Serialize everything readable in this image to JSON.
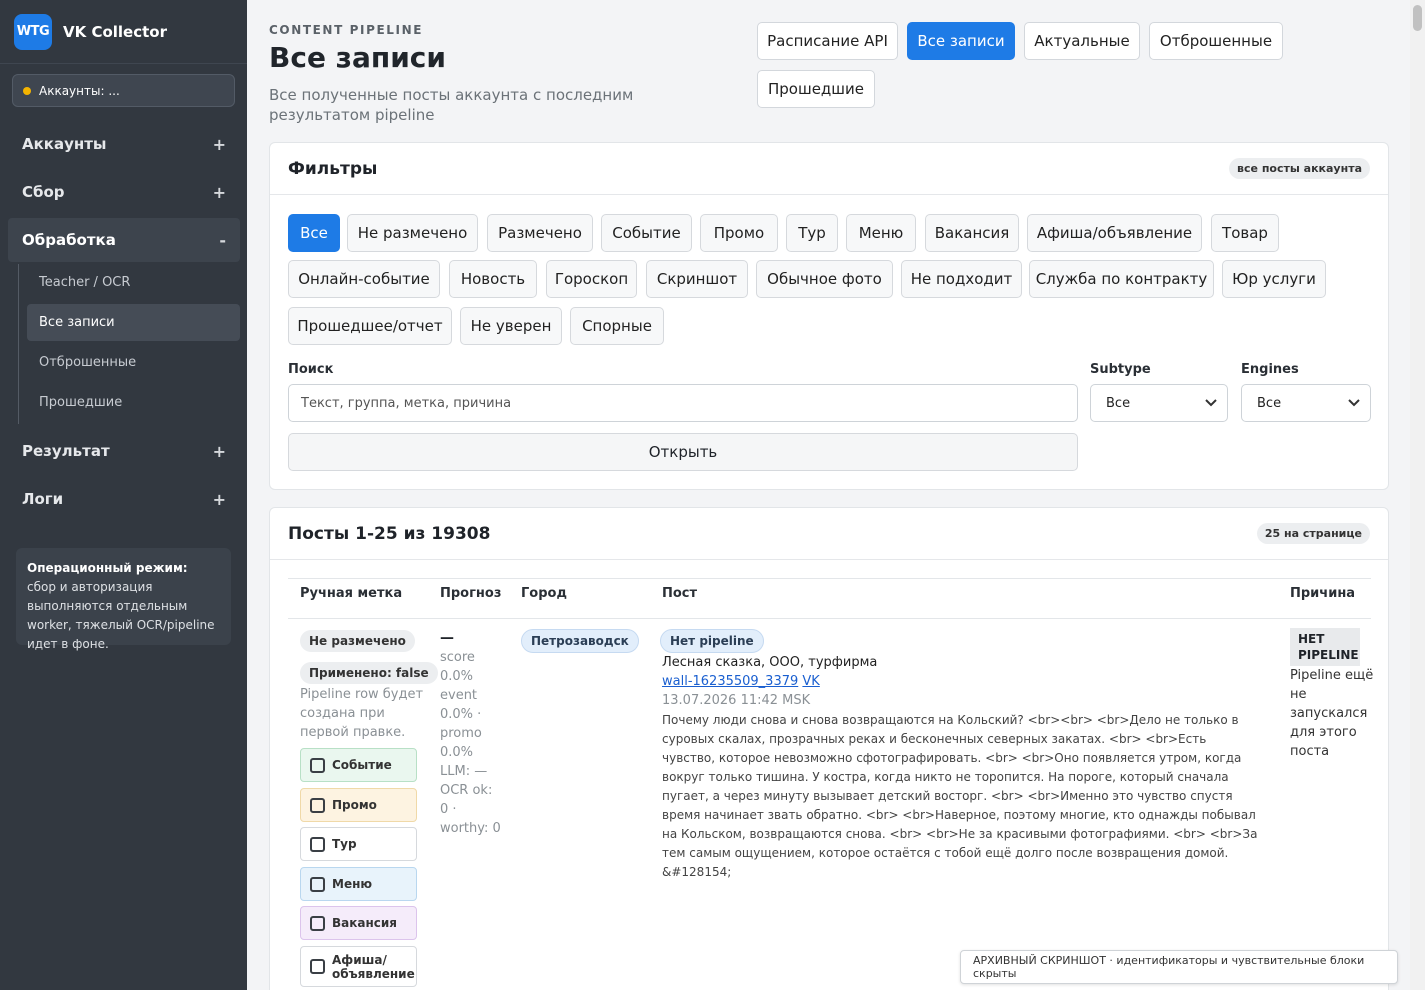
{
  "app": {
    "logo": "WTG",
    "name": "VK Collector"
  },
  "sidebar": {
    "account_selector": "Аккаунты: ...",
    "sections": [
      {
        "label": "Аккаунты",
        "sign": "+"
      },
      {
        "label": "Сбор",
        "sign": "+"
      },
      {
        "label": "Обработка",
        "sign": "-"
      },
      {
        "label": "Результат",
        "sign": "+"
      },
      {
        "label": "Логи",
        "sign": "+"
      }
    ],
    "subitems": [
      "Teacher / OCR",
      "Все записи",
      "Отброшенные",
      "Прошедшие"
    ],
    "note_bold": "Операционный режим:",
    "note_text": " сбор и авторизация выполняются отдельным worker, тяжелый OCR/pipeline идет в фоне."
  },
  "header": {
    "kicker": "CONTENT PIPELINE",
    "title": "Все записи",
    "subtitle": "Все полученные посты аккаунта с последним результатом pipeline",
    "buttons": [
      "Расписание API",
      "Все записи",
      "Актуальные",
      "Отброшенные",
      "Прошедшие"
    ]
  },
  "filters": {
    "title": "Фильтры",
    "badge": "все посты аккаунта",
    "chips": [
      "Все",
      "Не размечено",
      "Размечено",
      "Событие",
      "Промо",
      "Тур",
      "Меню",
      "Вакансия",
      "Афиша/объявление",
      "Товар",
      "Онлайн-событие",
      "Новость",
      "Гороскоп",
      "Скриншот",
      "Обычное фото",
      "Не подходит",
      "Служба по контракту",
      "Юр услуги",
      "Прошедшее/отчет",
      "Не уверен",
      "Спорные"
    ],
    "search_label": "Поиск",
    "search_placeholder": "Текст, группа, метка, причина",
    "subtype_label": "Subtype",
    "subtype_value": "Все",
    "engines_label": "Engines",
    "engines_value": "Все",
    "open_button": "Открыть"
  },
  "posts": {
    "title": "Посты 1-25 из 19308",
    "badge": "25 на странице",
    "columns": [
      "Ручная метка",
      "Прогноз",
      "Город",
      "Пост",
      "Причина"
    ],
    "row": {
      "tag1": "Не размечено",
      "tag2": "Применено: false",
      "hint": "Pipeline row будет создана при первой правке.",
      "checkboxes": [
        {
          "label": "Событие",
          "bg": "#eaf7ef",
          "border": "#b8e0c6"
        },
        {
          "label": "Промо",
          "bg": "#fdf3e1",
          "border": "#f0d9a8"
        },
        {
          "label": "Тур",
          "bg": "#ffffff",
          "border": "#d6d9dd"
        },
        {
          "label": "Меню",
          "bg": "#e8f3fb",
          "border": "#b9d7ef"
        },
        {
          "label": "Вакансия",
          "bg": "#f5ecfa",
          "border": "#dcc4ec"
        },
        {
          "label": "Афиша/ объявление",
          "bg": "#ffffff",
          "border": "#d6d9dd"
        }
      ],
      "forecast_dash": "—",
      "forecast": [
        "score",
        "0.0%",
        "event",
        "0.0% ·",
        "promo",
        "0.0%",
        "LLM: —",
        "OCR ok:",
        "0 ·",
        "worthy: 0"
      ],
      "city": "Петрозаводск",
      "pipeline_tag": "Нет pipeline",
      "group": "Лесная сказка, ООО, турфирма",
      "wall_link": "wall-16235509_3379",
      "vk_link": "VK",
      "date": "13.07.2026 11:42 MSK",
      "text": "Почему люди снова и снова возвращаются на Кольский? <br><br> <br>Дело не только в суровых скалах, прозрачных реках и бесконечных северных закатах. <br> <br>Есть чувство, которое невозможно сфотографировать. <br> <br>Оно появляется утром, когда вокруг только тишина. У костра, когда никто не торопится. На пороге, который сначала пугает, а через минуту вызывает детский восторг. <br> <br>Именно это чувство спустя время начинает звать обратно. <br> <br>Наверное, поэтому многие, кто однажды побывал на Кольском, возвращаются снова. <br> <br>Не за красивыми фотографиями. <br> <br>За тем самым ощущением, которое остаётся с тобой ещё долго после возвращения домой. &#128154;",
      "reason_tag": "НЕТ PIPELINE",
      "reason": "Pipeline ещё не запускался для этого поста"
    }
  },
  "archive_note": "АРХИВНЫЙ СКРИНШОТ · идентификаторы и чувствительные блоки скрыты",
  "colors": {
    "accent": "#1e7be6",
    "sidebar": "#323840"
  }
}
